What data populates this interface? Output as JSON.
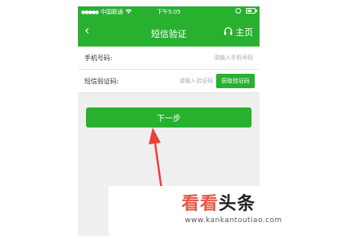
{
  "status_bar": {
    "carrier": "中国联通",
    "time": "下午5:05"
  },
  "nav": {
    "back_icon": "chevron-left-icon",
    "title": "短信验证",
    "home_label": "主页",
    "home_icon": "headset-icon"
  },
  "form": {
    "phone_label": "手机号码:",
    "phone_placeholder": "请输入手机号码",
    "code_label": "短信验证码:",
    "code_placeholder": "请输入验证码",
    "get_code_button": "获取验证码"
  },
  "next_button": "下一步",
  "watermark": {
    "brand_colored": "看看",
    "brand_dark": "头条",
    "url": "www.kankantoutiao.com"
  },
  "colors": {
    "primary": "#28b12f",
    "arrow": "#e8413b",
    "watermark": "#e7574a"
  }
}
